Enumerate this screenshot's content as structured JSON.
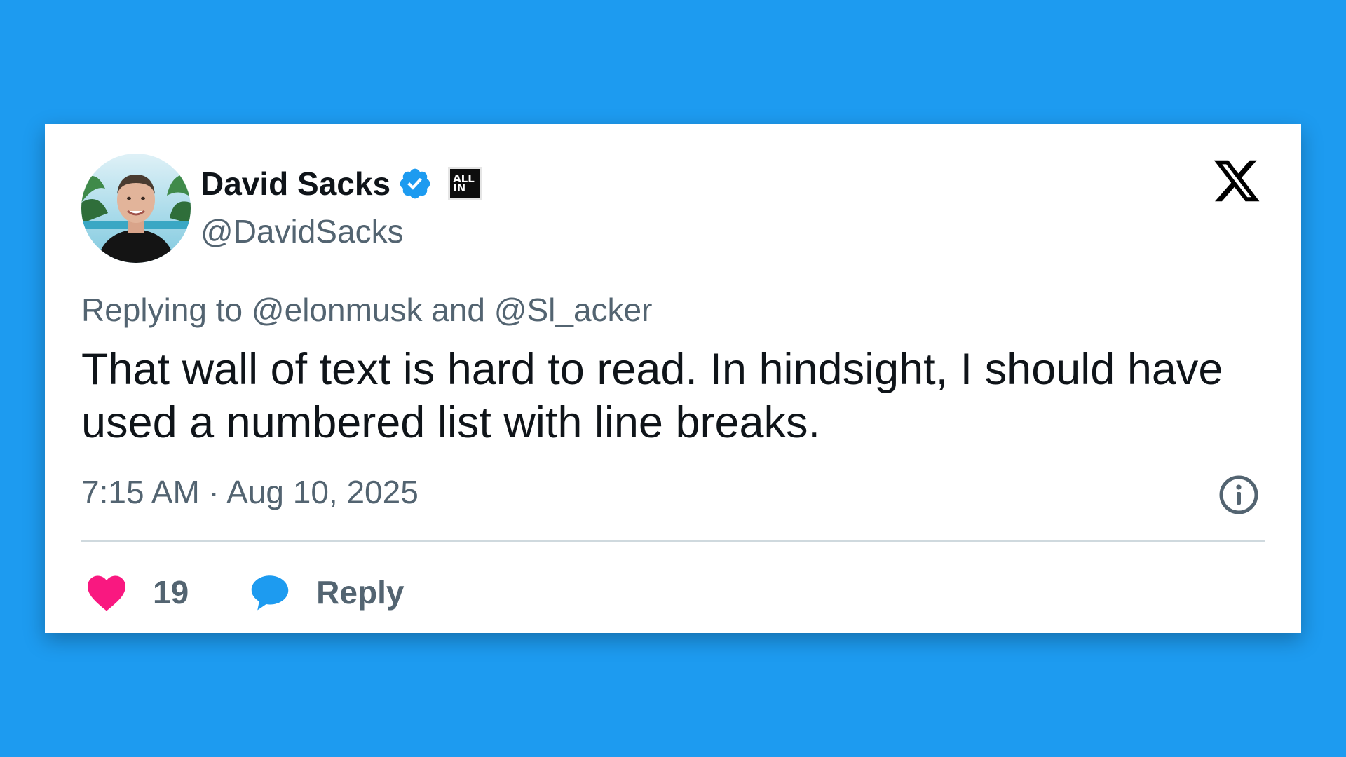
{
  "author": {
    "display_name": "David Sacks",
    "handle": "@DavidSacks",
    "verified_icon": "verified-badge-icon",
    "affiliate_badge": {
      "line1": "ALL",
      "line2": "IN"
    }
  },
  "platform_logo": "x-logo-icon",
  "reply_context": "Replying to @elonmusk and @Sl_acker",
  "tweet_text": "That wall of text is hard to read. In hindsight, I should have used a numbered list with line breaks.",
  "timestamp": "7:15 AM · Aug 10, 2025",
  "actions": {
    "like_count": "19",
    "reply_label": "Reply"
  },
  "colors": {
    "background": "#1d9bf0",
    "card": "#ffffff",
    "text_primary": "#0f1419",
    "text_secondary": "#536471",
    "verified": "#1d9bf0",
    "heart": "#f91880",
    "divider": "#cfd9de"
  }
}
